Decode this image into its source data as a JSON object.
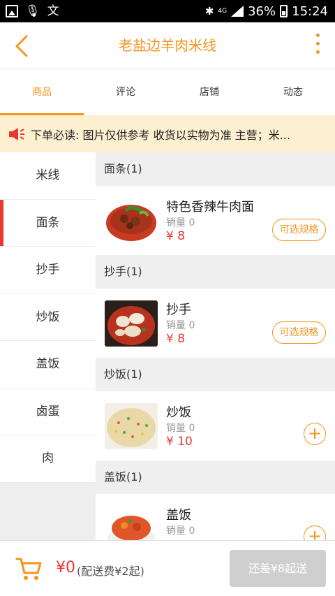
{
  "status_bar": {
    "network": "4G",
    "battery": "36%",
    "time": "15:24"
  },
  "header": {
    "title": "老盐边羊肉米线"
  },
  "tabs": [
    {
      "label": "商品",
      "active": true
    },
    {
      "label": "评论",
      "active": false
    },
    {
      "label": "店铺",
      "active": false
    },
    {
      "label": "动态",
      "active": false
    }
  ],
  "notice": {
    "text": "下单必读: 图片仅供参考 收货以实物为准  主营；米..."
  },
  "categories": [
    {
      "label": "米线",
      "active": false
    },
    {
      "label": "面条",
      "active": true
    },
    {
      "label": "抄手",
      "active": false
    },
    {
      "label": "炒饭",
      "active": false
    },
    {
      "label": "盖饭",
      "active": false
    },
    {
      "label": "卤蛋",
      "active": false
    },
    {
      "label": "肉",
      "active": false
    }
  ],
  "sections": [
    {
      "title": "面条(1)",
      "item": {
        "name": "特色香辣牛肉面",
        "sales": "销量 0",
        "price": "¥ 8",
        "action": "可选规格"
      }
    },
    {
      "title": "抄手(1)",
      "item": {
        "name": "抄手",
        "sales": "销量 0",
        "price": "¥ 8",
        "action": "可选规格"
      }
    },
    {
      "title": "炒饭(1)",
      "item": {
        "name": "炒饭",
        "sales": "销量 0",
        "price": "¥ 10",
        "action": "+"
      }
    },
    {
      "title": "盖饭(1)",
      "item": {
        "name": "盖饭",
        "sales": "销量 0",
        "price": "",
        "action": "+"
      }
    }
  ],
  "bottom": {
    "total": "¥0",
    "fee": "(配送费¥2起)",
    "checkout": "还差¥8起送"
  },
  "colors": {
    "accent": "#f5941d",
    "price": "#e8382f",
    "notice_bg": "#fdf0d0"
  }
}
